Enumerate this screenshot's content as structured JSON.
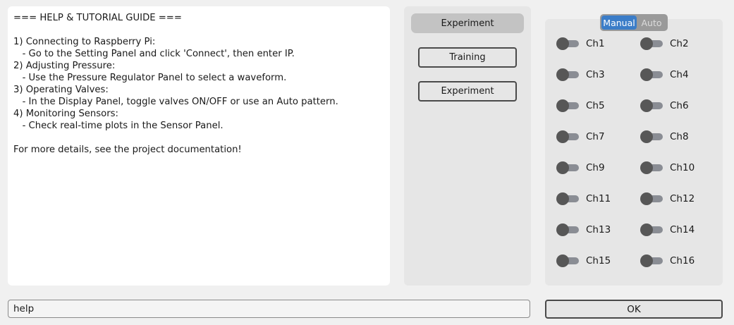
{
  "help": {
    "text": "=== HELP & TUTORIAL GUIDE ===\n\n1) Connecting to Raspberry Pi:\n   - Go to the Setting Panel and click 'Connect', then enter IP.\n2) Adjusting Pressure:\n   - Use the Pressure Regulator Panel to select a waveform.\n3) Operating Valves:\n   - In the Display Panel, toggle valves ON/OFF or use an Auto pattern.\n4) Monitoring Sensors:\n   - Check real-time plots in the Sensor Panel.\n\nFor more details, see the project documentation!"
  },
  "mode_panel": {
    "current_mode": "Experiment",
    "buttons": [
      {
        "label": "Training"
      },
      {
        "label": "Experiment"
      }
    ]
  },
  "valve_panel": {
    "mode_switch": {
      "manual_label": "Manual",
      "auto_label": "Auto",
      "selected": "Manual"
    },
    "channels": [
      {
        "label": "Ch1",
        "on": false
      },
      {
        "label": "Ch2",
        "on": false
      },
      {
        "label": "Ch3",
        "on": false
      },
      {
        "label": "Ch4",
        "on": false
      },
      {
        "label": "Ch5",
        "on": false
      },
      {
        "label": "Ch6",
        "on": false
      },
      {
        "label": "Ch7",
        "on": false
      },
      {
        "label": "Ch8",
        "on": false
      },
      {
        "label": "Ch9",
        "on": false
      },
      {
        "label": "Ch10",
        "on": false
      },
      {
        "label": "Ch11",
        "on": false
      },
      {
        "label": "Ch12",
        "on": false
      },
      {
        "label": "Ch13",
        "on": false
      },
      {
        "label": "Ch14",
        "on": false
      },
      {
        "label": "Ch15",
        "on": false
      },
      {
        "label": "Ch16",
        "on": false
      }
    ]
  },
  "command": {
    "value": "help",
    "ok_label": "OK"
  },
  "colors": {
    "accent": "#3b7dc8",
    "toggle_track": "#8a8d94",
    "toggle_knob": "#575757"
  }
}
